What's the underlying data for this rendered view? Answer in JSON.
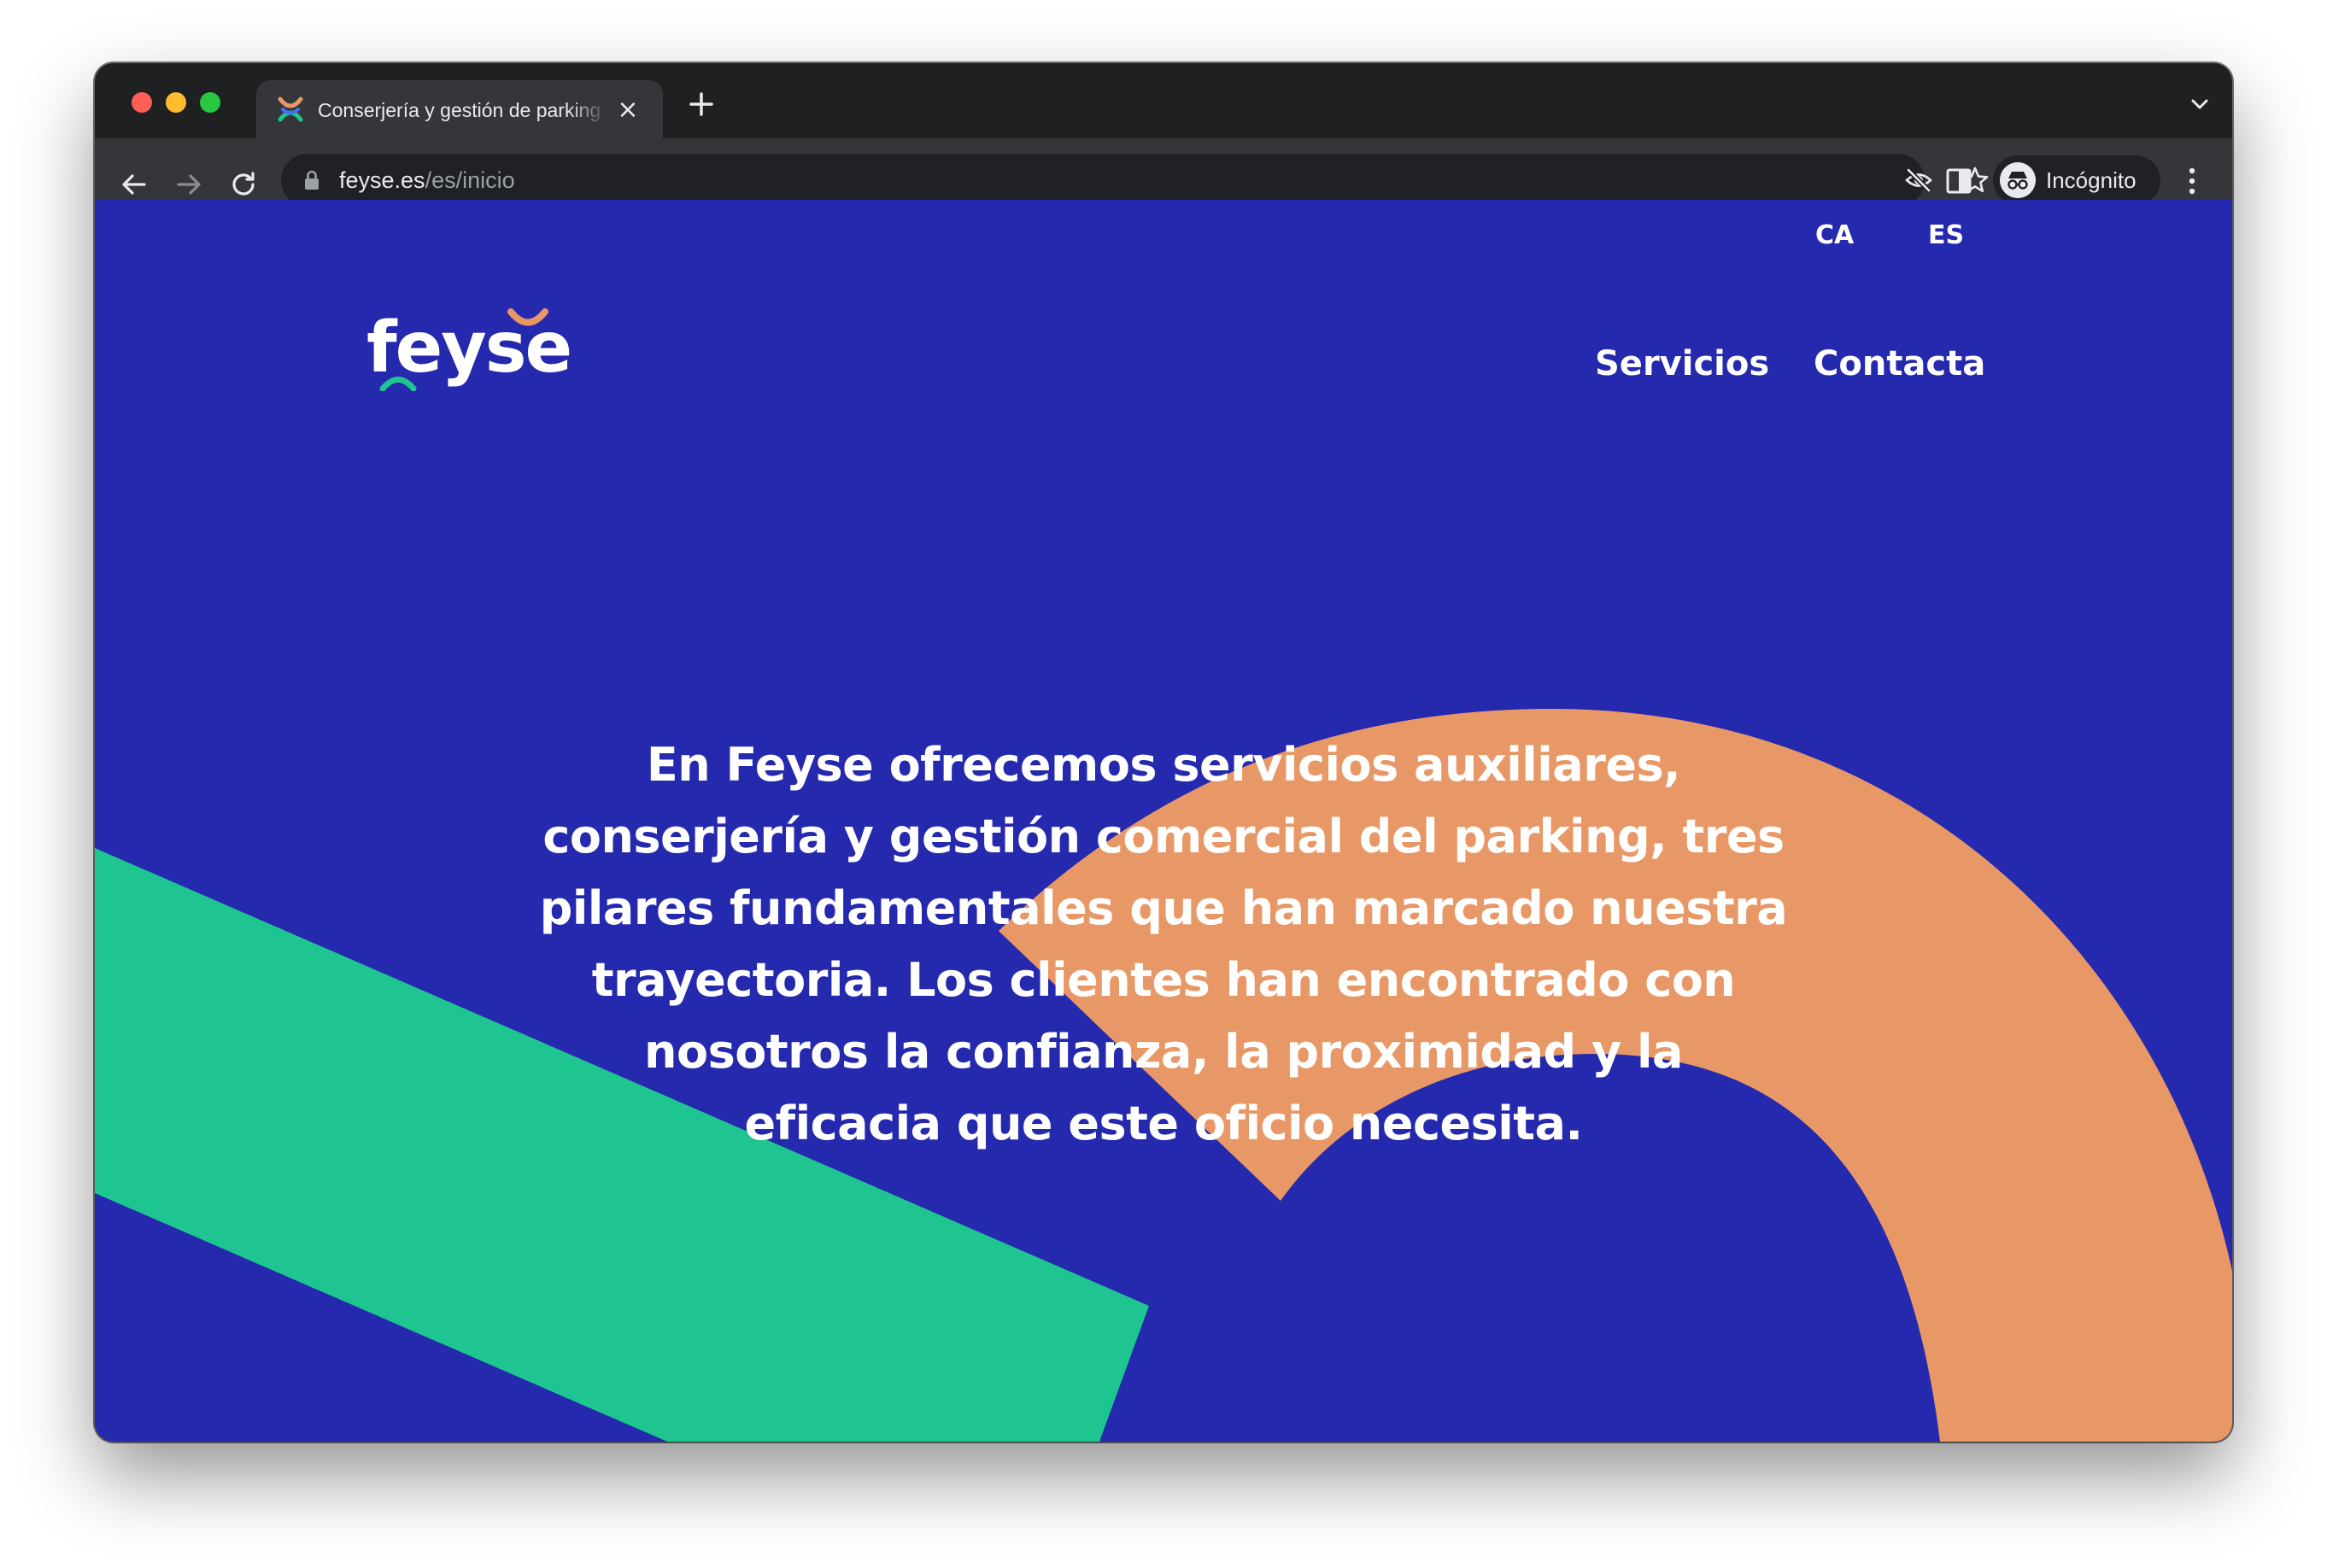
{
  "browser": {
    "tab_title": "Conserjería y gestión de parking",
    "tab_close_icon": "×",
    "url_domain": "feyse.es",
    "url_path": "/es/inicio",
    "profile_label": "Incógnito"
  },
  "site": {
    "languages": [
      "CA",
      "ES"
    ],
    "logo_text": "feyse",
    "nav": [
      "Servicios",
      "Contacta"
    ],
    "hero_text": "En Feyse ofrecemos servicios auxiliares, conserjería y gestión comercial del parking, tres pilares fundamentales que han marcado nuestra trayectoria. Los clientes han encontrado con nosotros la confianza, la proximidad y la eficacia que este oficio necesita."
  },
  "colors": {
    "page_background": "#2529ad",
    "accent_green": "#1fc590",
    "accent_orange": "#e89866",
    "text": "#ffffff"
  },
  "icons": [
    "back-arrow-icon",
    "forward-arrow-icon",
    "reload-icon",
    "lock-icon",
    "eye-off-icon",
    "star-icon",
    "side-panel-icon",
    "incognito-icon",
    "kebab-menu-icon",
    "new-tab-icon",
    "tab-list-icon"
  ]
}
